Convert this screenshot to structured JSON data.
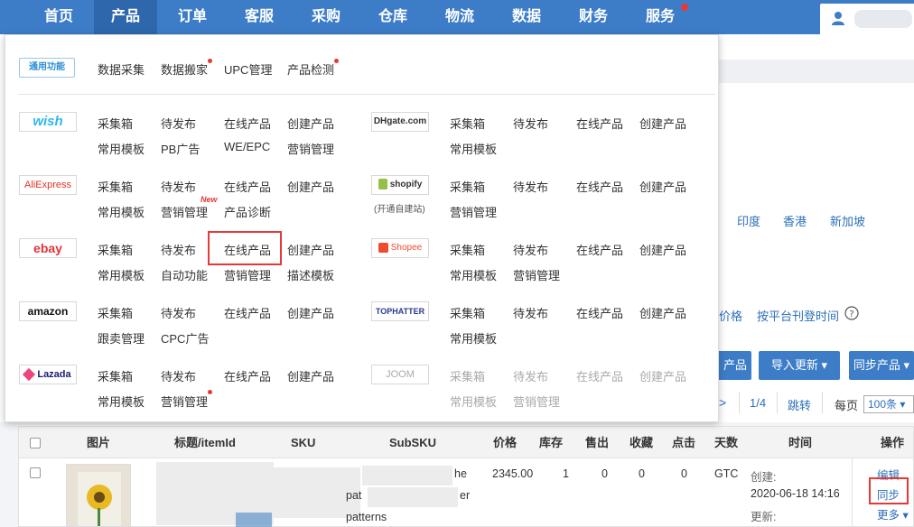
{
  "nav": {
    "items": [
      "首页",
      "产品",
      "订单",
      "客服",
      "采购",
      "仓库",
      "物流",
      "数据",
      "财务",
      "服务"
    ],
    "active": "产品"
  },
  "dropdown": {
    "general": {
      "logo": "通用功能",
      "links": [
        "数据采集",
        "数据搬家",
        "UPC管理",
        "产品检测"
      ]
    },
    "platforms": {
      "wish": {
        "logo": "wish",
        "row1": [
          "采集箱",
          "待发布",
          "在线产品",
          "创建产品"
        ],
        "row2": [
          "常用模板",
          "PB广告",
          "WE/EPC",
          "营销管理"
        ]
      },
      "dhgate": {
        "logo": "DHgate.com",
        "row1": [
          "采集箱",
          "待发布",
          "在线产品",
          "创建产品"
        ],
        "row2": [
          "常用模板"
        ]
      },
      "aliexpress": {
        "logo": "AliExpress",
        "row1": [
          "采集箱",
          "待发布",
          "在线产品",
          "创建产品"
        ],
        "row2": [
          "常用模板",
          "营销管理",
          "产品诊断"
        ],
        "new_tag": "New"
      },
      "shopify": {
        "logo": "shopify",
        "caption": "(开通自建站)",
        "row1": [
          "采集箱",
          "待发布",
          "在线产品",
          "创建产品"
        ],
        "row2": [
          "营销管理"
        ]
      },
      "ebay": {
        "logo": "ebay",
        "row1": [
          "采集箱",
          "待发布",
          "在线产品",
          "创建产品"
        ],
        "row2": [
          "常用模板",
          "自动功能",
          "营销管理",
          "描述模板"
        ]
      },
      "shopee": {
        "logo": "Shopee",
        "row1": [
          "采集箱",
          "待发布",
          "在线产品",
          "创建产品"
        ],
        "row2": [
          "常用模板",
          "营销管理"
        ]
      },
      "amazon": {
        "logo": "amazon",
        "row1": [
          "采集箱",
          "待发布",
          "在线产品",
          "创建产品"
        ],
        "row2": [
          "跟卖管理",
          "CPC广告"
        ]
      },
      "tophatter": {
        "logo": "TOPHATTER",
        "row1": [
          "采集箱",
          "待发布",
          "在线产品",
          "创建产品"
        ],
        "row2": [
          "常用模板"
        ]
      },
      "lazada": {
        "logo": "Lazada",
        "row1": [
          "采集箱",
          "待发布",
          "在线产品",
          "创建产品"
        ],
        "row2": [
          "常用模板",
          "营销管理"
        ]
      },
      "joom": {
        "logo": "JOOM",
        "row1": [
          "采集箱",
          "待发布",
          "在线产品",
          "创建产品"
        ],
        "row2": [
          "常用模板",
          "营销管理"
        ]
      }
    }
  },
  "background": {
    "site_links": [
      "印度",
      "香港",
      "新加坡"
    ],
    "filter_price": "价格",
    "filter_time": "按平台刊登时间",
    "buttons": {
      "partial": "产品",
      "import_update": "导入更新 ▾",
      "sync": "同步产品 ▾"
    },
    "pager": {
      "page": "1/4",
      "jump": "跳转",
      "per_page_label": "每页",
      "per_page": "100条 ▾",
      "next": ">"
    },
    "table": {
      "headers": [
        "图片",
        "标题/itemId",
        "SKU",
        "SubSKU",
        "价格",
        "库存",
        "售出",
        "收藏",
        "点击",
        "天数",
        "时间",
        "操作"
      ],
      "row": {
        "title_fragments": [
          "he",
          "pat",
          "er",
          "patterns"
        ],
        "price": "2345.00",
        "stock": "1",
        "sold": "0",
        "favorites": "0",
        "clicks": "0",
        "days": "GTC",
        "created_label": "创建:",
        "created_time": "2020-06-18 14:16",
        "updated_label": "更新:",
        "actions": {
          "edit": "编辑",
          "sync": "同步",
          "more": "更多 ▾"
        }
      }
    }
  },
  "colors": {
    "nav": "#3d7dc8",
    "nav_active": "#2f67ad",
    "link": "#2d6fb8",
    "highlight": "#e53935"
  }
}
